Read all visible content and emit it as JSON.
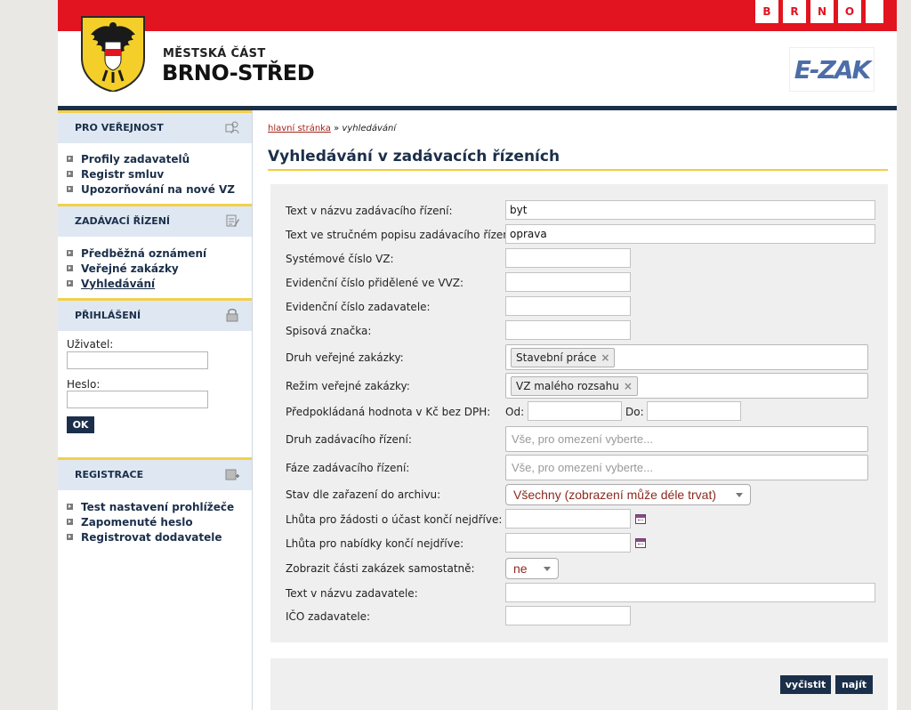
{
  "header": {
    "brno_letters": [
      "B",
      "R",
      "N",
      "O"
    ],
    "district_line1": "MĚSTSKÁ ČÁST",
    "district_line2": "BRNO-STŘED",
    "app_logo": "E-ZAK"
  },
  "sidebar": {
    "public": {
      "title": "PRO VEŘEJNOST",
      "icon": "people-icon",
      "items": [
        "Profily zadavatelů",
        "Registr smluv",
        "Upozorňování na nové VZ"
      ]
    },
    "procurement": {
      "title": "ZADÁVACÍ ŘÍZENÍ",
      "icon": "document-edit-icon",
      "items": [
        "Předběžná oznámení",
        "Veřejné zakázky",
        "Vyhledávání"
      ],
      "active_index": 2
    },
    "login": {
      "title": "PŘIHLÁŠENÍ",
      "icon": "lock-icon",
      "user_label": "Uživatel:",
      "password_label": "Heslo:",
      "ok_label": "OK"
    },
    "registration": {
      "title": "REGISTRACE",
      "icon": "register-icon",
      "items": [
        "Test nastavení prohlížeče",
        "Zapomenuté heslo",
        "Registrovat dodavatele"
      ]
    }
  },
  "breadcrumb": {
    "home": "hlavní stránka",
    "separator": "»",
    "current": "vyhledávání"
  },
  "page_title": "Vyhledávání v zadávacích řízeních",
  "form": {
    "name_label": "Text v názvu zadávacího řízení:",
    "name_value": "byt",
    "desc_label": "Text ve stručném popisu zadávacího řízení:",
    "desc_value": "oprava",
    "system_no_label": "Systémové číslo VZ:",
    "vvz_no_label": "Evidenční číslo přidělené ve VVZ:",
    "contracting_no_label": "Evidenční číslo zadavatele:",
    "file_mark_label": "Spisová značka:",
    "type_label": "Druh veřejné zakázky:",
    "type_tag": "Stavební práce",
    "mode_label": "Režim veřejné zakázky:",
    "mode_tag": "VZ malého rozsahu",
    "value_label": "Předpokládaná hodnota v Kč bez DPH:",
    "value_from_label": "Od:",
    "value_to_label": "Do:",
    "procedure_label": "Druh zadávacího řízení:",
    "procedure_placeholder": "Vše, pro omezení vyberte...",
    "phase_label": "Fáze zadávacího řízení:",
    "phase_placeholder": "Vše, pro omezení vyberte...",
    "archive_label": "Stav dle zařazení do archivu:",
    "archive_value": "Všechny (zobrazení může déle trvat)",
    "request_deadline_label": "Lhůta pro žádosti o účast končí nejdříve:",
    "offer_deadline_label": "Lhůta pro nabídky končí nejdříve:",
    "parts_label": "Zobrazit části zakázek samostatně:",
    "parts_value": "ne",
    "contractor_name_label": "Text v názvu zadavatele:",
    "ico_label": "IČO zadavatele:"
  },
  "buttons": {
    "clear": "vyčistit",
    "search": "najít"
  }
}
